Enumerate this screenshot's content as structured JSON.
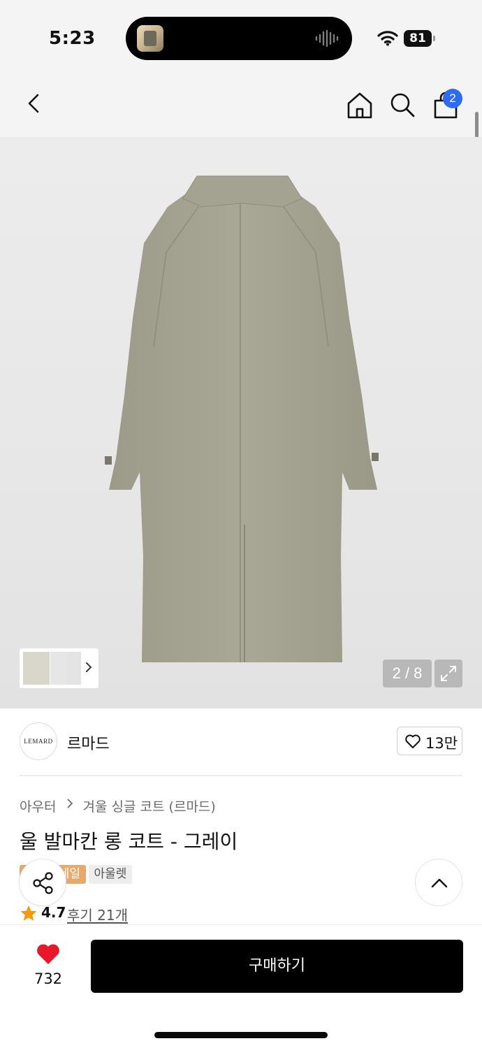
{
  "status_bar": {
    "time": "5:23",
    "battery": "81",
    "icons": [
      "now-playing-thumbnail",
      "audio-waveform-icon",
      "wifi-icon",
      "battery-icon"
    ]
  },
  "nav": {
    "icons": [
      "back-chevron-icon",
      "home-icon",
      "search-icon",
      "shopping-bag-icon"
    ],
    "cart_count": "2"
  },
  "gallery": {
    "page_indicator": "2 / 8",
    "icons": [
      "thumbnail-strip",
      "chevron-right-icon",
      "expand-icon"
    ]
  },
  "brand": {
    "logo_text": "LEMARD",
    "name": "르마드",
    "like_count": "13만"
  },
  "product": {
    "breadcrumb": [
      "아우터",
      "겨울 싱글 코트 (르마드)"
    ],
    "title": "울 발마칸 롱 코트 - 그레이",
    "tags": [
      "세일",
      "아울렛"
    ],
    "rating": "4.7",
    "review_link": "후기 21개"
  },
  "bottom_bar": {
    "wish_count": "732",
    "buy_label": "구매하기"
  },
  "colors": {
    "accent_badge": "#2f6bf2",
    "sale_tag": "#e8a86c",
    "wish_heart": "#e8172a",
    "star": "#f59a0c",
    "buy_button": "#000000"
  }
}
